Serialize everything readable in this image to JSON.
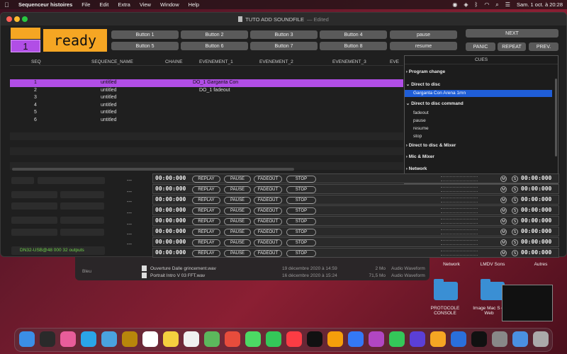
{
  "menubar": {
    "app_name": "Sequenceur histoires",
    "menus": [
      "File",
      "Edit",
      "Extra",
      "View",
      "Window",
      "Help"
    ],
    "clock": "Sam. 1 oct. à  20:28"
  },
  "window": {
    "title": "TUTO ADD SOUNDFILE",
    "edited": "— Edited"
  },
  "status": {
    "ready_text": "ready",
    "sequence_number": "1",
    "device": "DN32-USB@48 000 32 outputs"
  },
  "buttons": {
    "row1": [
      "Button 1",
      "Button 2",
      "Button 3",
      "Button 4",
      "pause"
    ],
    "row2": [
      "Button 5",
      "Button 6",
      "Button 7",
      "Button 8",
      "resume"
    ],
    "next": "NEXT",
    "panic": "PANIC",
    "repeat": "REPEAT",
    "prev": "PREV."
  },
  "table": {
    "headers": [
      "SEQ",
      "SEQUENCE_NAME",
      "CHAINE",
      "EVENEMENT_1",
      "EVENEMENT_2",
      "EVENEMENT_3",
      "EVE"
    ],
    "rows": [
      {
        "seq": "1",
        "name": "untitled",
        "chaine": "",
        "ev1": "DO_1 Garganta Con"
      },
      {
        "seq": "2",
        "name": "untitled",
        "chaine": "",
        "ev1": "DO_1 fadeout"
      },
      {
        "seq": "3",
        "name": "untitled",
        "chaine": "",
        "ev1": ""
      },
      {
        "seq": "4",
        "name": "untitled",
        "chaine": "",
        "ev1": ""
      },
      {
        "seq": "5",
        "name": "untitled",
        "chaine": "",
        "ev1": ""
      },
      {
        "seq": "6",
        "name": "untitled",
        "chaine": "",
        "ev1": ""
      }
    ]
  },
  "cues": {
    "title": "CUES",
    "items": [
      {
        "label": "Program change",
        "type": "group",
        "expanded": false
      },
      {
        "label": "Direct to disc",
        "type": "group",
        "expanded": true
      },
      {
        "label": "Garganta Con Arena 1mn",
        "type": "item",
        "selected": true
      },
      {
        "label": "Direct to disc command",
        "type": "group",
        "expanded": true
      },
      {
        "label": "fadeout",
        "type": "item"
      },
      {
        "label": "pause",
        "type": "item"
      },
      {
        "label": "resume",
        "type": "item"
      },
      {
        "label": "stop",
        "type": "item"
      },
      {
        "label": "Direct to disc & Mixer",
        "type": "group",
        "expanded": false
      },
      {
        "label": "Mic & Mixer",
        "type": "group",
        "expanded": false
      },
      {
        "label": "Network",
        "type": "group",
        "expanded": false
      }
    ]
  },
  "players": {
    "time": "00:00:000",
    "buttons": [
      "REPLAY",
      "PAUSE",
      "FADEOUT",
      "STOP"
    ],
    "m_label": "M",
    "s_label": "S",
    "left_dash": "---",
    "count": 8
  },
  "finder": {
    "files": [
      {
        "name": "Ouverture Dalle grincement.wav",
        "date": "19 décembre 2020 à 14:59",
        "size": "2 Mo",
        "kind": "Audio Waveform"
      },
      {
        "name": "Portrait Intro V 03 FFT.wav",
        "date": "16 décembre 2020 à 15:24",
        "size": "71,5 Mo",
        "kind": "Audio Waveform"
      }
    ],
    "sidebar_item": "Bleu"
  },
  "desktop": {
    "labels": [
      "Network",
      "LMDV Sons",
      "Autres",
      "PROTOCOLE CONSOLE",
      "Image Mac S et Web"
    ]
  }
}
